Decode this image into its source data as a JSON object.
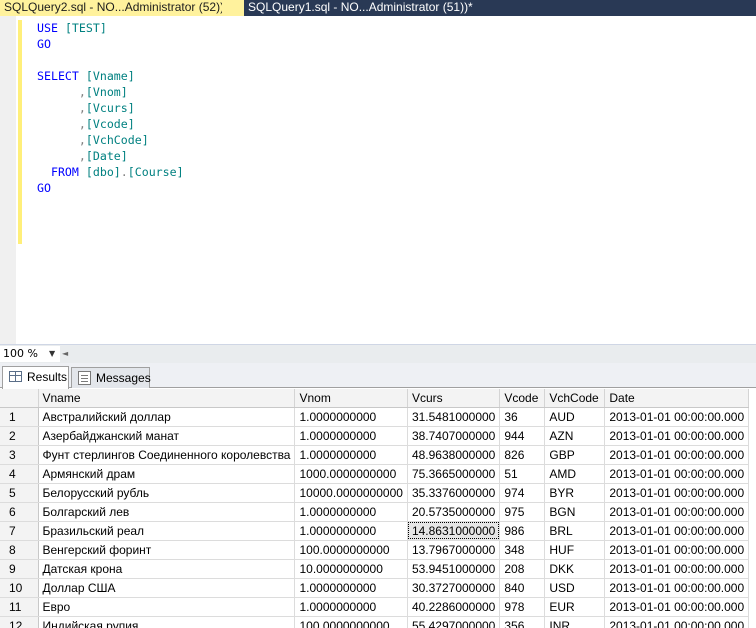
{
  "tabs": [
    {
      "label": "SQLQuery2.sql - NO...Administrator (52))",
      "active": true
    },
    {
      "label": "SQLQuery1.sql - NO...Administrator (51))*",
      "active": false
    }
  ],
  "editor": {
    "lines": [
      [
        {
          "t": "USE",
          "c": "kw"
        },
        {
          "t": " ",
          "c": "txt"
        },
        {
          "t": "[TEST]",
          "c": "id"
        }
      ],
      [
        {
          "t": "GO",
          "c": "kw"
        }
      ],
      [],
      [
        {
          "t": "SELECT",
          "c": "kw"
        },
        {
          "t": " ",
          "c": "txt"
        },
        {
          "t": "[Vname]",
          "c": "id"
        }
      ],
      [
        {
          "t": "      ",
          "c": "txt"
        },
        {
          "t": ",",
          "c": "pun"
        },
        {
          "t": "[Vnom]",
          "c": "id"
        }
      ],
      [
        {
          "t": "      ",
          "c": "txt"
        },
        {
          "t": ",",
          "c": "pun"
        },
        {
          "t": "[Vcurs]",
          "c": "id"
        }
      ],
      [
        {
          "t": "      ",
          "c": "txt"
        },
        {
          "t": ",",
          "c": "pun"
        },
        {
          "t": "[Vcode]",
          "c": "id"
        }
      ],
      [
        {
          "t": "      ",
          "c": "txt"
        },
        {
          "t": ",",
          "c": "pun"
        },
        {
          "t": "[VchCode]",
          "c": "id"
        }
      ],
      [
        {
          "t": "      ",
          "c": "txt"
        },
        {
          "t": ",",
          "c": "pun"
        },
        {
          "t": "[Date]",
          "c": "id"
        }
      ],
      [
        {
          "t": "  ",
          "c": "txt"
        },
        {
          "t": "FROM",
          "c": "kw"
        },
        {
          "t": " ",
          "c": "txt"
        },
        {
          "t": "[dbo]",
          "c": "id"
        },
        {
          "t": ".",
          "c": "pun"
        },
        {
          "t": "[Course]",
          "c": "id"
        }
      ],
      [
        {
          "t": "GO",
          "c": "kw"
        }
      ]
    ]
  },
  "zoom": {
    "value": "100 %"
  },
  "result_tabs": {
    "results": "Results",
    "messages": "Messages"
  },
  "grid": {
    "columns": [
      "Vname",
      "Vnom",
      "Vcurs",
      "Vcode",
      "VchCode",
      "Date"
    ],
    "rows": [
      [
        "1",
        "Австралийский доллар",
        "1.0000000000",
        "31.5481000000",
        "36",
        "AUD",
        "2013-01-01 00:00:00.000"
      ],
      [
        "2",
        "Азербайджанский манат",
        "1.0000000000",
        "38.7407000000",
        "944",
        "AZN",
        "2013-01-01 00:00:00.000"
      ],
      [
        "3",
        "Фунт стерлингов Соединенного королевства",
        "1.0000000000",
        "48.9638000000",
        "826",
        "GBP",
        "2013-01-01 00:00:00.000"
      ],
      [
        "4",
        "Армянский драм",
        "1000.0000000000",
        "75.3665000000",
        "51",
        "AMD",
        "2013-01-01 00:00:00.000"
      ],
      [
        "5",
        "Белорусский рубль",
        "10000.0000000000",
        "35.3376000000",
        "974",
        "BYR",
        "2013-01-01 00:00:00.000"
      ],
      [
        "6",
        "Болгарский лев",
        "1.0000000000",
        "20.5735000000",
        "975",
        "BGN",
        "2013-01-01 00:00:00.000"
      ],
      [
        "7",
        "Бразильский реал",
        "1.0000000000",
        "14.8631000000",
        "986",
        "BRL",
        "2013-01-01 00:00:00.000"
      ],
      [
        "8",
        "Венгерский форинт",
        "100.0000000000",
        "13.7967000000",
        "348",
        "HUF",
        "2013-01-01 00:00:00.000"
      ],
      [
        "9",
        "Датская крона",
        "10.0000000000",
        "53.9451000000",
        "208",
        "DKK",
        "2013-01-01 00:00:00.000"
      ],
      [
        "10",
        "Доллар США",
        "1.0000000000",
        "30.3727000000",
        "840",
        "USD",
        "2013-01-01 00:00:00.000"
      ],
      [
        "11",
        "Евро",
        "1.0000000000",
        "40.2286000000",
        "978",
        "EUR",
        "2013-01-01 00:00:00.000"
      ],
      [
        "12",
        "Индийская рупия",
        "100.0000000000",
        "55.4297000000",
        "356",
        "INR",
        "2013-01-01 00:00:00.000"
      ]
    ],
    "selected": {
      "row": 6,
      "col": 3
    }
  }
}
